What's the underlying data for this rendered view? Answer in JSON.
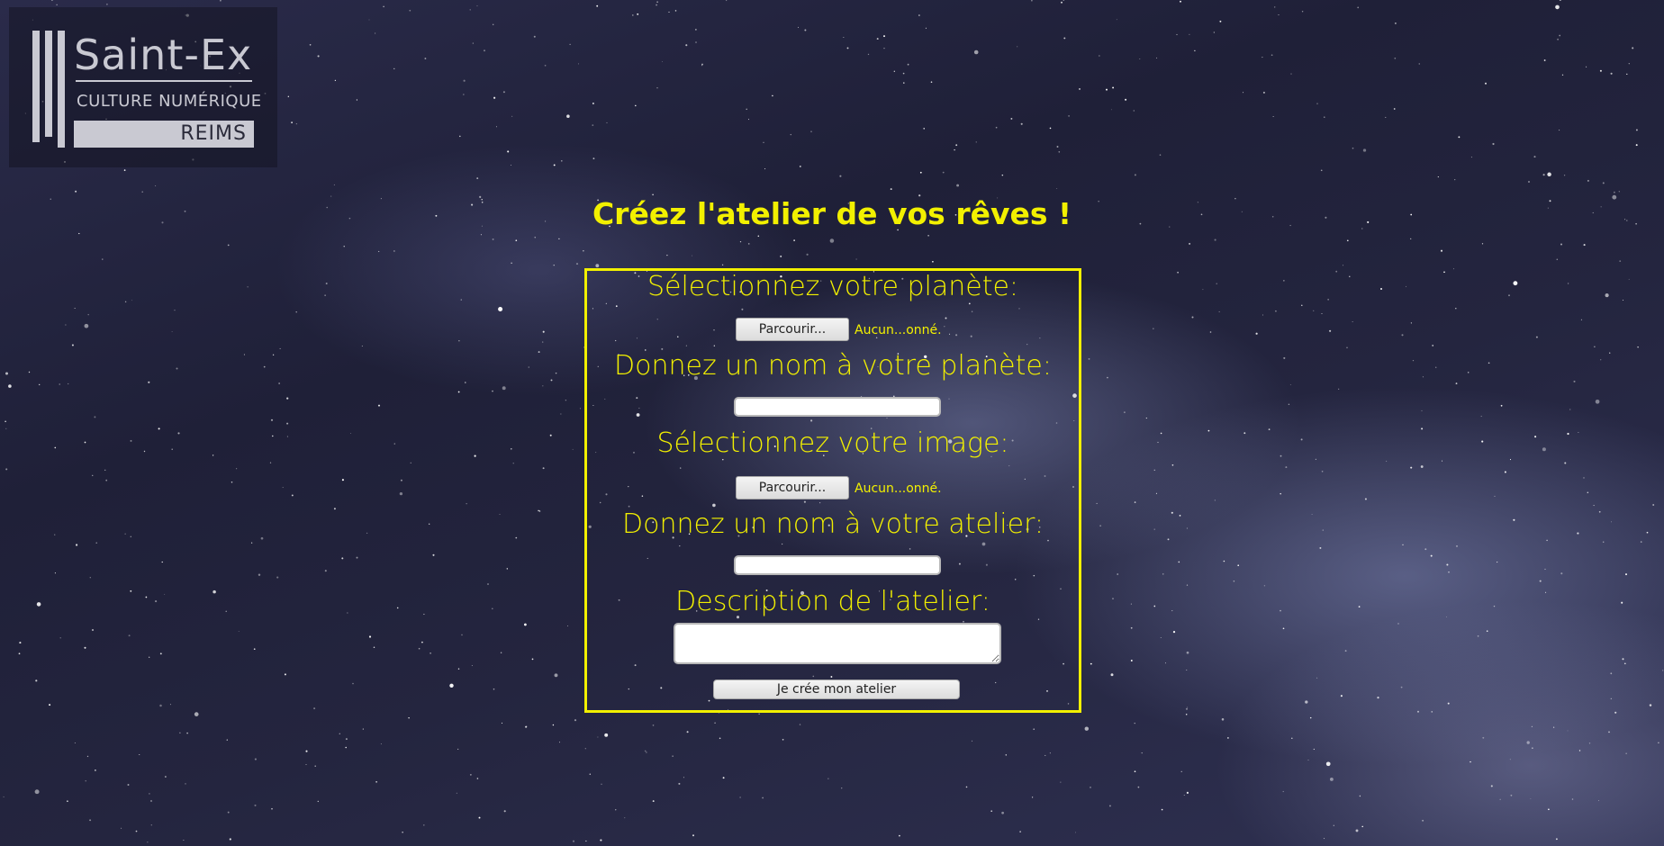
{
  "logo": {
    "title": "Saint-Ex",
    "subtitle": "CULTURE NUMÉRIQUE",
    "city": "REIMS"
  },
  "heading": "Créez l'atelier de vos rêves !",
  "form": {
    "planet_file_label": "Sélectionnez votre planète:",
    "planet_browse_button": "Parcourir...",
    "planet_file_status": "Aucun...onné.",
    "planet_name_label": "Donnez un nom à votre planète:",
    "planet_name_value": "",
    "image_file_label": "Sélectionnez votre image:",
    "image_browse_button": "Parcourir...",
    "image_file_status": "Aucun...onné.",
    "workshop_name_label": "Donnez un nom à votre atelier:",
    "workshop_name_value": "",
    "description_label": "Description de l'atelier:",
    "description_value": "",
    "submit_label": "Je crée mon atelier"
  },
  "colors": {
    "accent": "#f2f000",
    "background": "#22233d"
  }
}
